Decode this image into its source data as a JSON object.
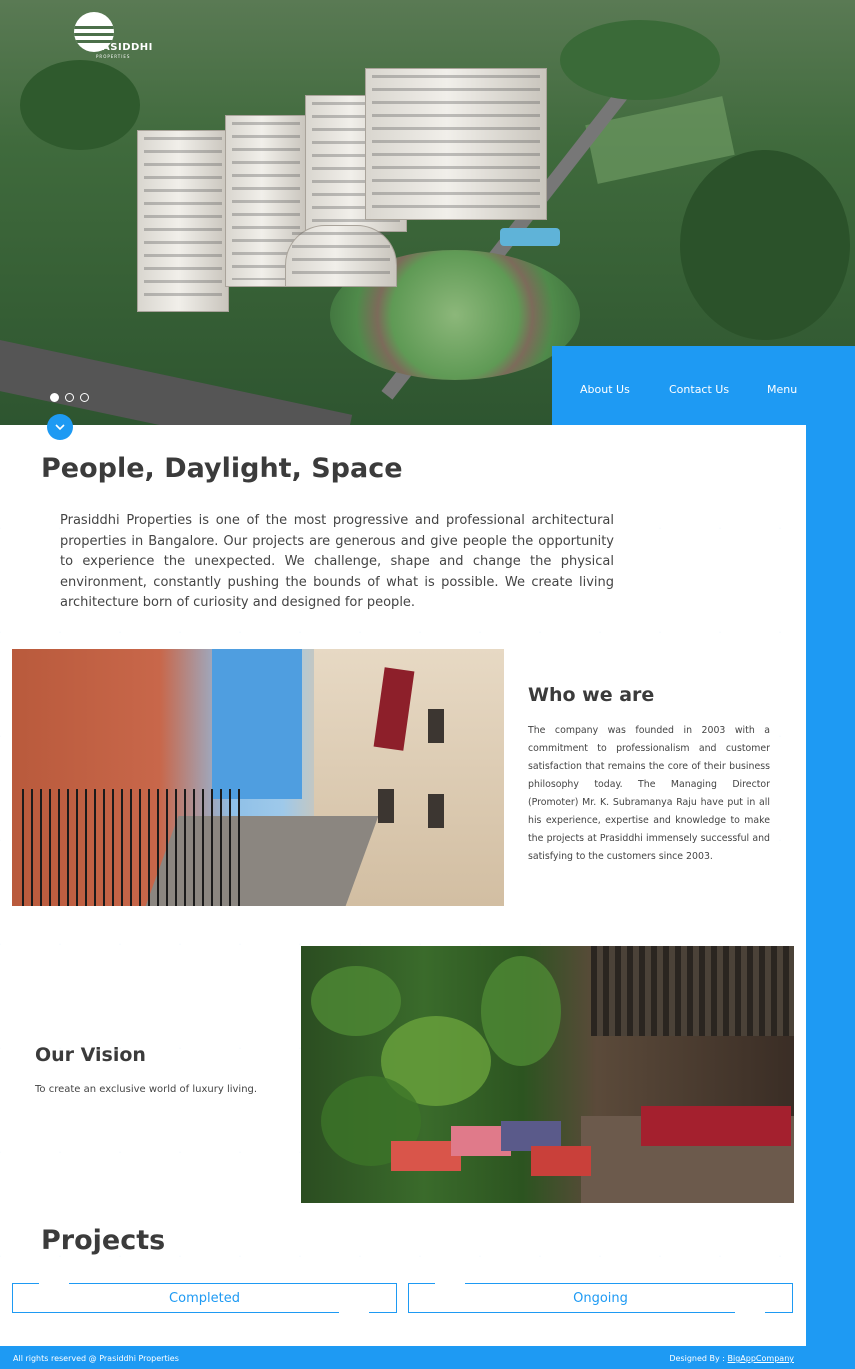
{
  "brand": {
    "name": "PRASIDDHI",
    "tagline": "PROPERTIES"
  },
  "nav": {
    "items": [
      "About Us",
      "Contact Us",
      "Menu"
    ]
  },
  "hero": {
    "slides_total": 3,
    "active_slide": 1
  },
  "intro": {
    "title": "People, Daylight, Space",
    "text": "Prasiddhi Properties is one of the most progressive and professional architectural properties in Bangalore. Our projects are generous and give people the opportunity to experience the unexpected. We challenge, shape and change the physical environment, constantly pushing the bounds of what is possible. We create living architecture born of curiosity and designed for people."
  },
  "who": {
    "title": "Who we are",
    "text": "The company was founded in 2003 with a commitment to professionalism and customer satisfaction that remains the core of their business philosophy today. The Managing Director (Promoter) Mr. K. Subramanya Raju have put in all his experience, expertise and knowledge to make the projects at Prasiddhi immensely successful and satisfying to the customers since 2003."
  },
  "vision": {
    "title": "Our Vision",
    "text": "To create an exclusive world of luxury living."
  },
  "projects": {
    "title": "Projects",
    "tabs": [
      "Completed",
      "Ongoing"
    ]
  },
  "footer": {
    "left": "All rights reserved @ Prasiddhi Properties",
    "designed_by_label": "Designed By :",
    "designed_by_link": "BigAppCompany"
  },
  "colors": {
    "accent": "#1e9af3",
    "heading": "#3b3b3b",
    "body_text": "#444444"
  },
  "icons": {
    "scroll_down": "chevron-down-icon"
  }
}
